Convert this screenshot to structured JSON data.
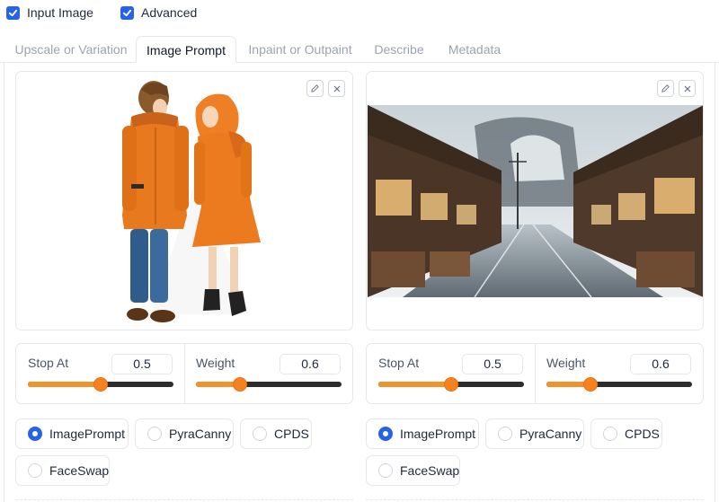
{
  "options": {
    "input_image": {
      "label": "Input Image",
      "checked": true
    },
    "advanced": {
      "label": "Advanced",
      "checked": true
    }
  },
  "tabs": [
    {
      "label": "Upscale or Variation",
      "active": false
    },
    {
      "label": "Image Prompt",
      "active": true
    },
    {
      "label": "Inpaint or Outpaint",
      "active": false
    },
    {
      "label": "Describe",
      "active": false
    },
    {
      "label": "Metadata",
      "active": false
    }
  ],
  "slots": [
    {
      "image": "anime-couple-orange-coats",
      "stop_at": {
        "label": "Stop At",
        "value": "0.5",
        "fraction": 0.5
      },
      "weight": {
        "label": "Weight",
        "value": "0.6",
        "fraction": 0.3
      },
      "types": [
        {
          "label": "ImagePrompt",
          "selected": true
        },
        {
          "label": "PyraCanny",
          "selected": false
        },
        {
          "label": "CPDS",
          "selected": false
        },
        {
          "label": "FaceSwap",
          "selected": false
        }
      ]
    },
    {
      "image": "japanese-street-misty",
      "stop_at": {
        "label": "Stop At",
        "value": "0.5",
        "fraction": 0.5
      },
      "weight": {
        "label": "Weight",
        "value": "0.6",
        "fraction": 0.3
      },
      "types": [
        {
          "label": "ImagePrompt",
          "selected": true
        },
        {
          "label": "PyraCanny",
          "selected": false
        },
        {
          "label": "CPDS",
          "selected": false
        },
        {
          "label": "FaceSwap",
          "selected": false
        }
      ]
    }
  ],
  "colors": {
    "accent": "#2563eb",
    "slider": "#f5821f",
    "track": "#2d2d2d",
    "border": "#e5e7eb"
  }
}
